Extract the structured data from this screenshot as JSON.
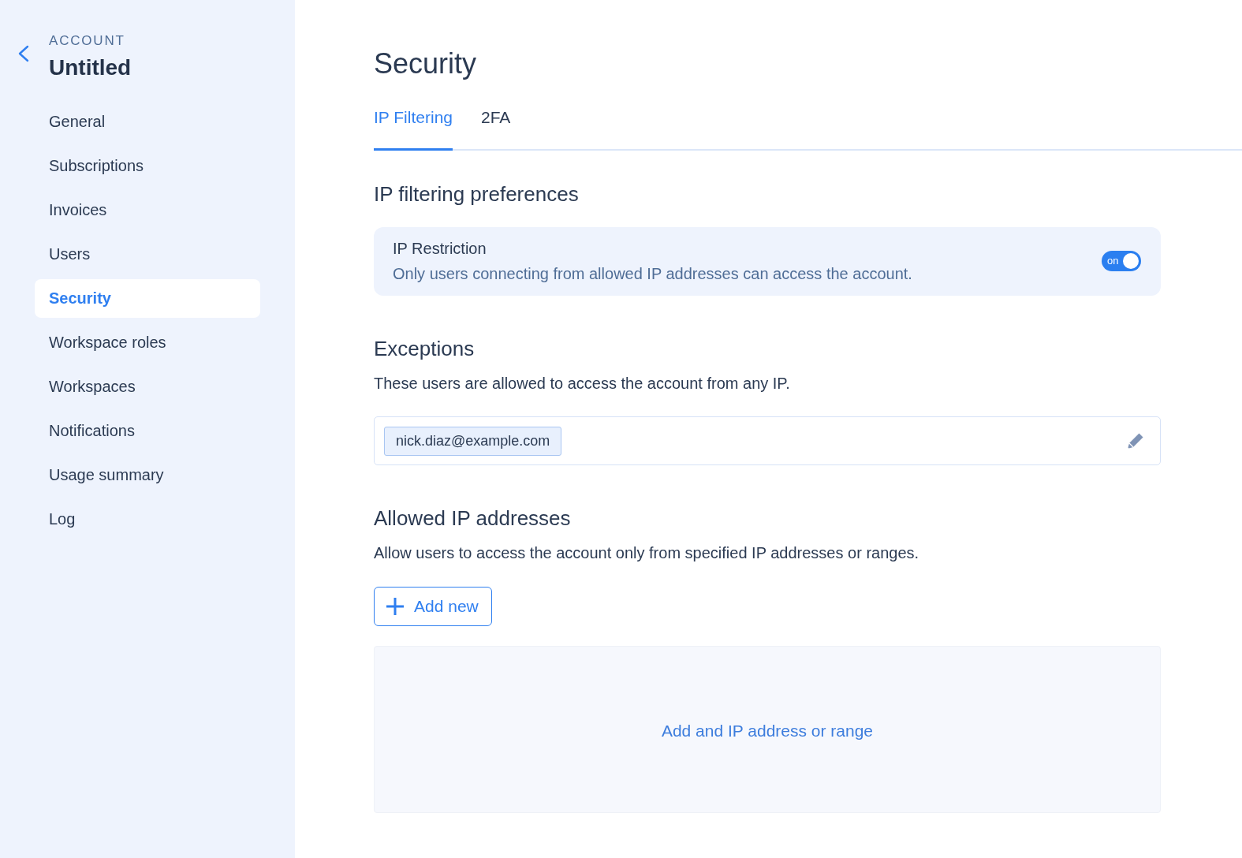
{
  "sidebar": {
    "section": "ACCOUNT",
    "title": "Untitled",
    "items": [
      {
        "label": "General",
        "selected": false
      },
      {
        "label": "Subscriptions",
        "selected": false
      },
      {
        "label": "Invoices",
        "selected": false
      },
      {
        "label": "Users",
        "selected": false
      },
      {
        "label": "Security",
        "selected": true
      },
      {
        "label": "Workspace roles",
        "selected": false
      },
      {
        "label": "Workspaces",
        "selected": false
      },
      {
        "label": "Notifications",
        "selected": false
      },
      {
        "label": "Usage summary",
        "selected": false
      },
      {
        "label": "Log",
        "selected": false
      }
    ]
  },
  "page": {
    "title": "Security"
  },
  "tabs": [
    {
      "label": "IP Filtering",
      "selected": true
    },
    {
      "label": "2FA",
      "selected": false
    }
  ],
  "ip_filtering": {
    "heading": "IP filtering preferences",
    "restriction": {
      "title": "IP Restriction",
      "description": "Only users connecting from allowed IP addresses can access the account.",
      "toggle": {
        "label": "on",
        "on": true
      }
    }
  },
  "exceptions": {
    "heading": "Exceptions",
    "description": "These users are allowed to access the account from any IP.",
    "users": [
      "nick.diaz@example.com"
    ]
  },
  "allowed_ips": {
    "heading": "Allowed IP addresses",
    "description": "Allow users to access the account only from specified IP addresses or ranges.",
    "add_button": "Add new",
    "empty_message": "Add and IP address or range"
  }
}
